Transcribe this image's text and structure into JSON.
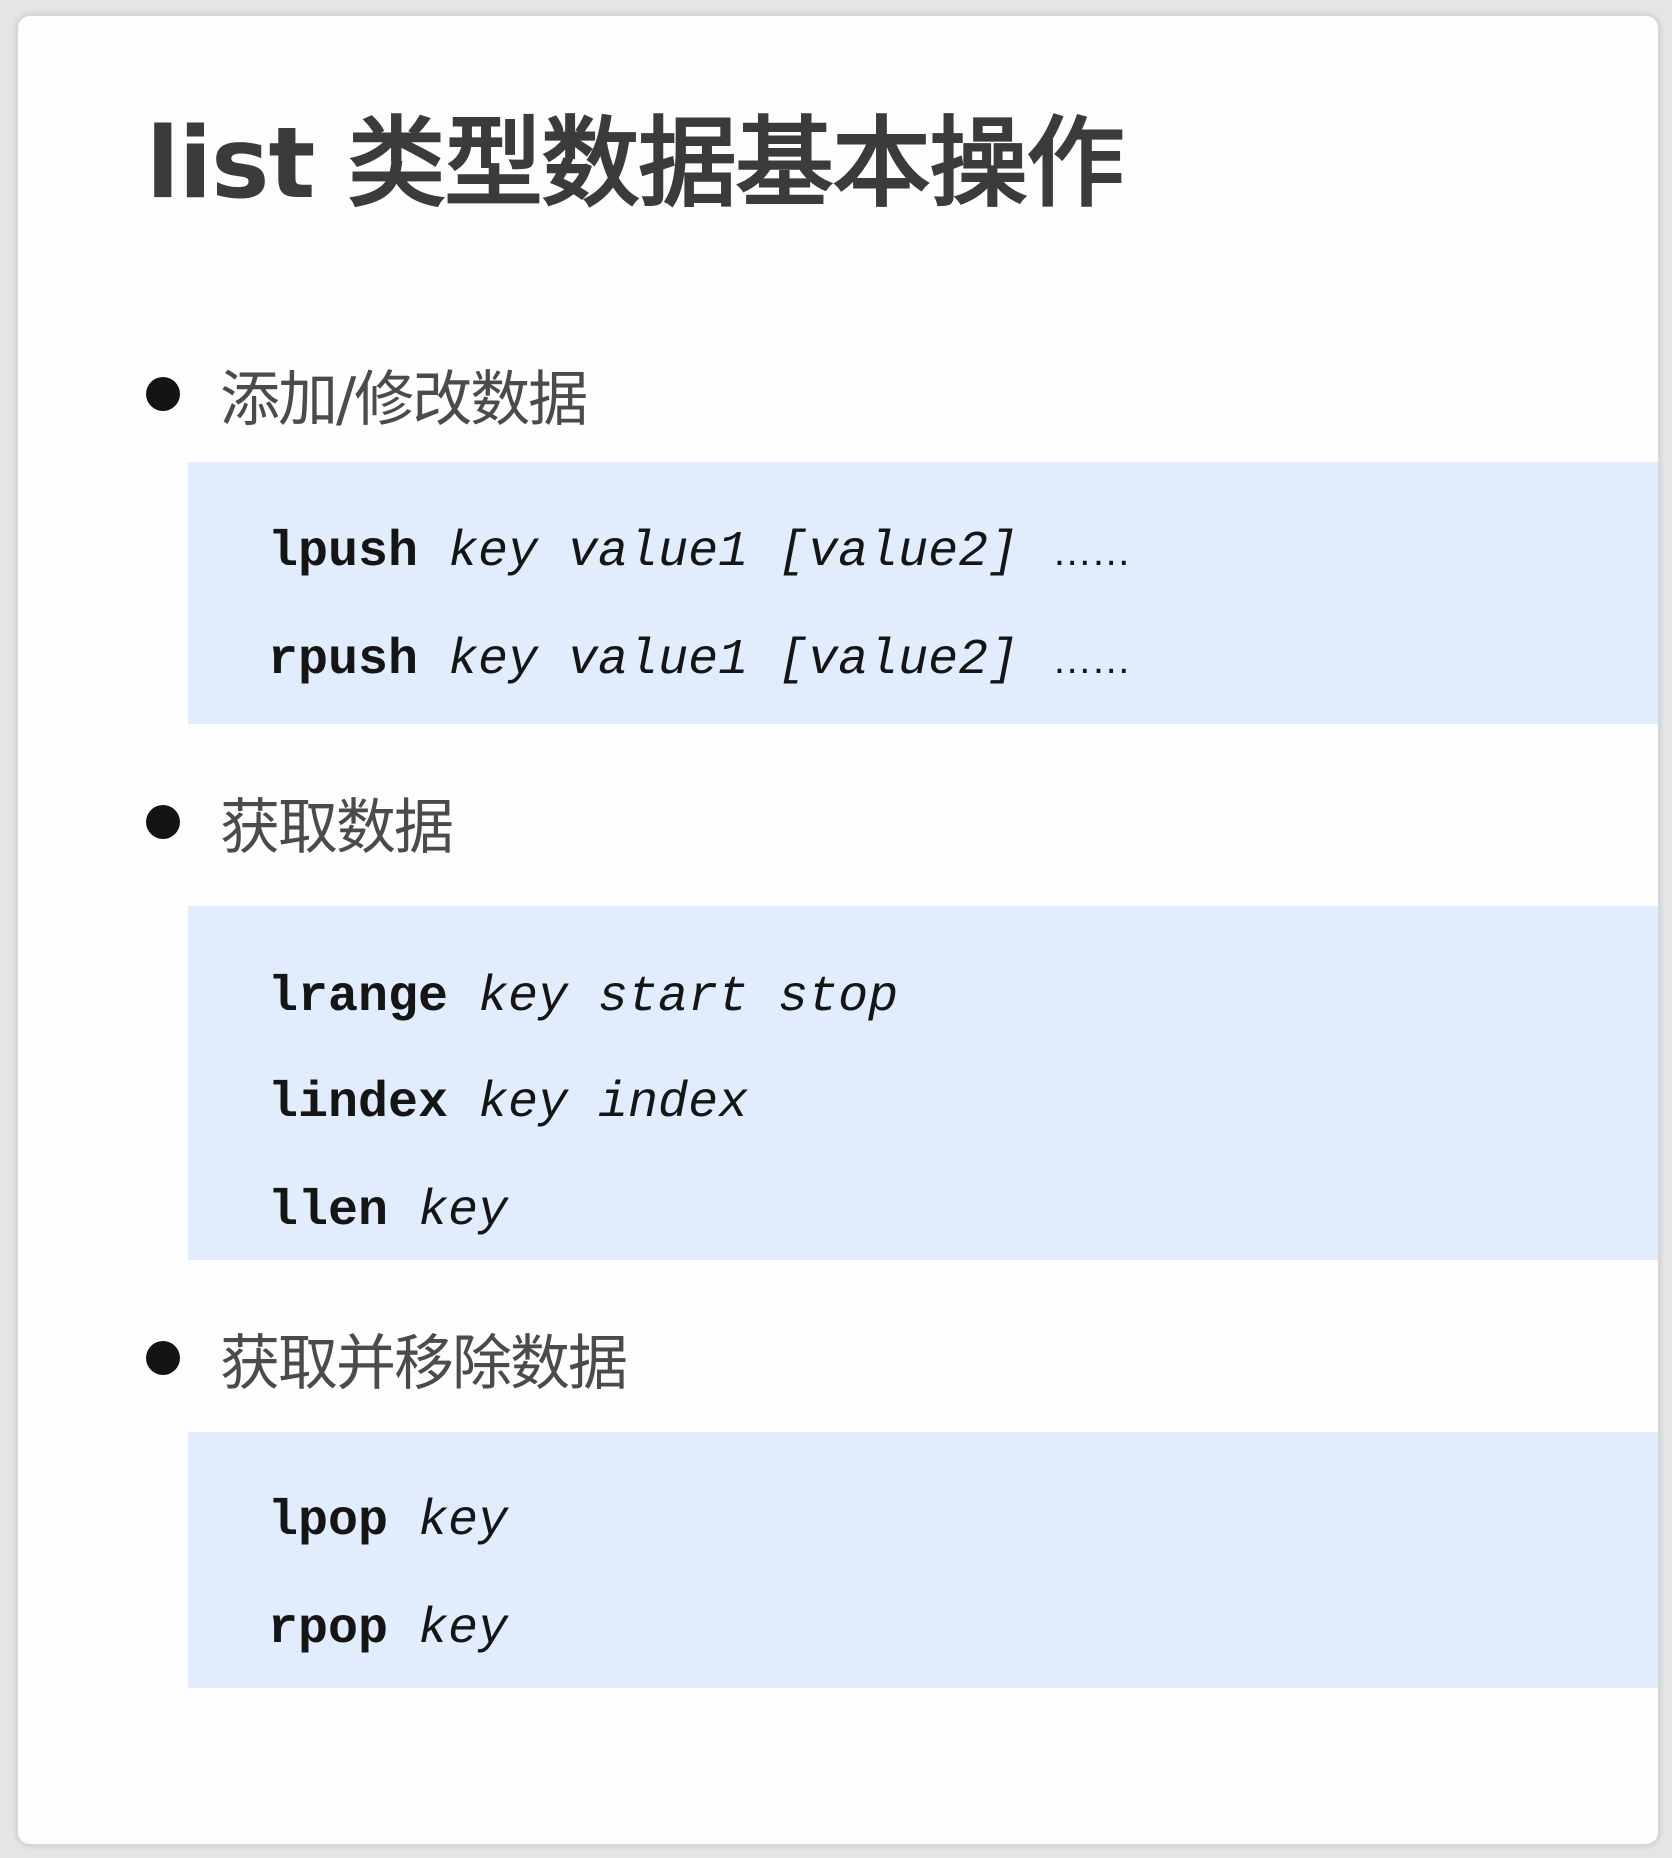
{
  "title": "list 类型数据基本操作",
  "sections": [
    {
      "heading": "添加/修改数据",
      "commands": [
        {
          "cmd": "lpush",
          "args": "key value1 [value2]",
          "suffix": "……"
        },
        {
          "cmd": "rpush",
          "args": "key value1 [value2]",
          "suffix": "……"
        }
      ]
    },
    {
      "heading": "获取数据",
      "commands": [
        {
          "cmd": "lrange",
          "args": "key start stop"
        },
        {
          "cmd": "lindex",
          "args": "key index"
        },
        {
          "cmd": "llen",
          "args": "key"
        }
      ]
    },
    {
      "heading": "获取并移除数据",
      "commands": [
        {
          "cmd": "lpop",
          "args": "key"
        },
        {
          "cmd": "rpop",
          "args": "key"
        }
      ]
    }
  ]
}
